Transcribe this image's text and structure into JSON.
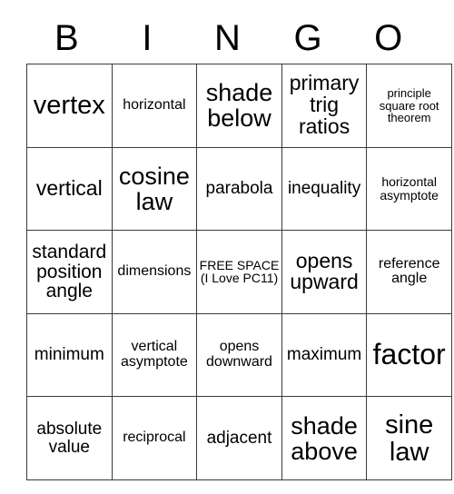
{
  "card": {
    "header_letters": [
      "B",
      "I",
      "N",
      "G",
      "O"
    ],
    "columns": 5,
    "rows": 5,
    "grid": [
      [
        {
          "text": "vertex",
          "size": "fs-xl"
        },
        {
          "text": "horizontal",
          "size": "fs-xs"
        },
        {
          "text": "shade below",
          "size": "fs-l"
        },
        {
          "text": "primary trig ratios",
          "size": "fs-m"
        },
        {
          "text": "principle square root theorem",
          "size": "fs-tiny"
        }
      ],
      [
        {
          "text": "vertical",
          "size": "fs-m"
        },
        {
          "text": "cosine law",
          "size": "fs-l"
        },
        {
          "text": "parabola",
          "size": "fs-s"
        },
        {
          "text": "inequality",
          "size": "fs-s"
        },
        {
          "text": "horizontal asymptote",
          "size": "fs-xxs"
        }
      ],
      [
        {
          "text": "standard position angle",
          "size": "fs-ms"
        },
        {
          "text": "dimensions",
          "size": "fs-xs"
        },
        {
          "text": "FREE SPACE (I Love PC11)",
          "size": "fs-xxs"
        },
        {
          "text": "opens upward",
          "size": "fs-m"
        },
        {
          "text": "reference angle",
          "size": "fs-xs"
        }
      ],
      [
        {
          "text": "minimum",
          "size": "fs-s"
        },
        {
          "text": "vertical asymptote",
          "size": "fs-xs"
        },
        {
          "text": "opens downward",
          "size": "fs-xs"
        },
        {
          "text": "maximum",
          "size": "fs-s"
        },
        {
          "text": "factor",
          "size": "fs-xxl"
        }
      ],
      [
        {
          "text": "absolute value",
          "size": "fs-s"
        },
        {
          "text": "reciprocal",
          "size": "fs-xs"
        },
        {
          "text": "adjacent",
          "size": "fs-s"
        },
        {
          "text": "shade above",
          "size": "fs-l"
        },
        {
          "text": "sine law",
          "size": "fs-xl"
        }
      ]
    ]
  },
  "colors": {
    "background": "#ffffff",
    "text": "#000000",
    "grid_line": "#3a3a3a"
  }
}
